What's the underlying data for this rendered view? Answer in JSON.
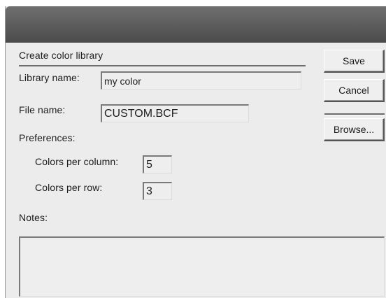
{
  "dialog": {
    "group_title": "Create color library",
    "library_name_label": "Library name:",
    "library_name_value": "my color",
    "file_name_label": "File name:",
    "file_name_value": "CUSTOM.BCF",
    "preferences_label": "Preferences:",
    "colors_per_column_label": "Colors per column:",
    "colors_per_column_value": "5",
    "colors_per_row_label": "Colors per row:",
    "colors_per_row_value": "3",
    "notes_label": "Notes:",
    "notes_value": ""
  },
  "buttons": {
    "save": "Save",
    "cancel": "Cancel",
    "browse": "Browse..."
  }
}
